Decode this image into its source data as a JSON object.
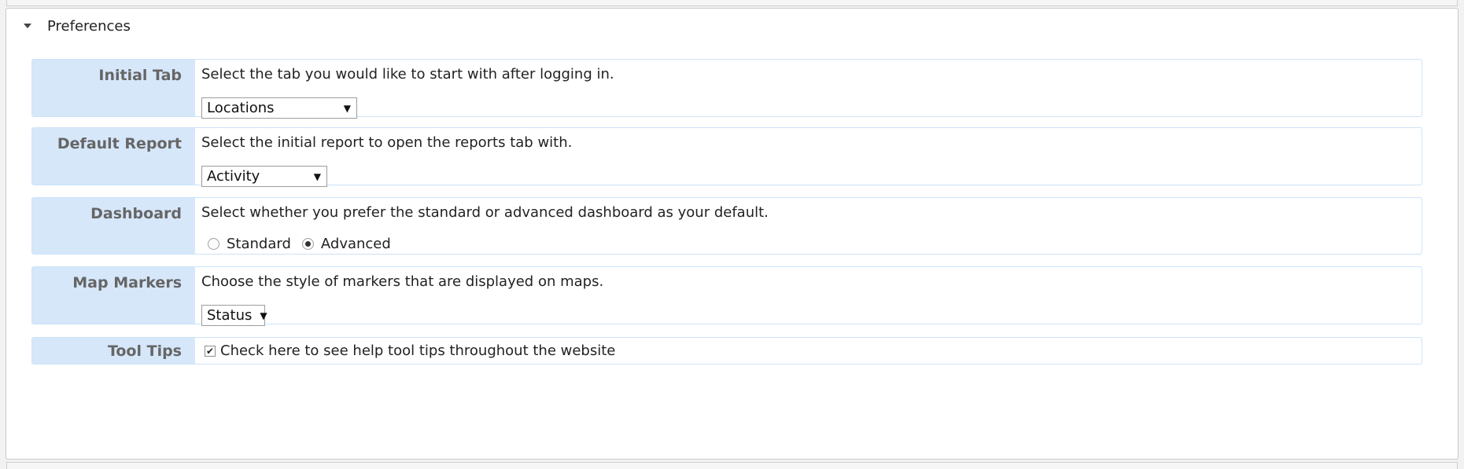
{
  "panel": {
    "title": "Preferences"
  },
  "rows": {
    "initial_tab": {
      "label": "Initial Tab",
      "description": "Select the tab you would like to start with after logging in.",
      "selected": "Locations"
    },
    "default_report": {
      "label": "Default Report",
      "description": "Select the initial report to open the reports tab with.",
      "selected": "Activity"
    },
    "dashboard": {
      "label": "Dashboard",
      "description": "Select whether you prefer the standard or advanced dashboard as your default.",
      "options": [
        {
          "label": "Standard",
          "checked": false
        },
        {
          "label": "Advanced",
          "checked": true
        }
      ]
    },
    "map_markers": {
      "label": "Map Markers",
      "description": "Choose the style of markers that are displayed on maps.",
      "selected": "Status"
    },
    "tool_tips": {
      "label": "Tool Tips",
      "checkbox_label": "Check here to see help tool tips throughout the website",
      "checked": true
    }
  },
  "colors": {
    "label_bg": "#d6e7fa",
    "row_border": "#cde3f7",
    "label_text": "#666666"
  },
  "icons": {
    "collapse": "caret-down-icon",
    "select_arrow": "select-arrow-icon"
  }
}
